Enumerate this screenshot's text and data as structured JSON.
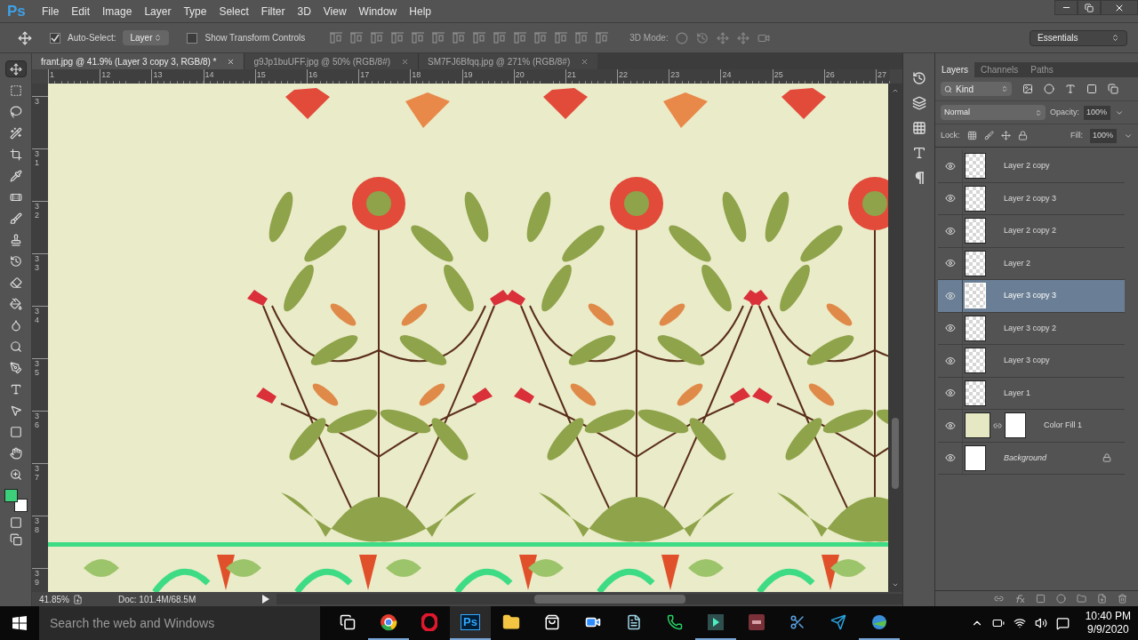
{
  "app": {
    "logo": "Ps",
    "menu": [
      "File",
      "Edit",
      "Image",
      "Layer",
      "Type",
      "Select",
      "Filter",
      "3D",
      "View",
      "Window",
      "Help"
    ]
  },
  "options_bar": {
    "auto_select": {
      "label": "Auto-Select:",
      "checked": true,
      "target": "Layer"
    },
    "transform_controls": {
      "label": "Show Transform Controls",
      "checked": false
    },
    "mode_label": "3D Mode:",
    "workspace": "Essentials"
  },
  "tools": [
    {
      "kind": "move",
      "selected": true
    },
    {
      "kind": "marquee",
      "selected": false
    },
    {
      "kind": "lasso",
      "selected": false
    },
    {
      "kind": "wand",
      "selected": false
    },
    {
      "kind": "crop",
      "selected": false
    },
    {
      "kind": "eyedropper",
      "selected": false
    },
    {
      "kind": "healing",
      "selected": false
    },
    {
      "kind": "brush",
      "selected": false
    },
    {
      "kind": "stamp",
      "selected": false
    },
    {
      "kind": "history",
      "selected": false
    },
    {
      "kind": "eraser",
      "selected": false
    },
    {
      "kind": "bucket",
      "selected": false
    },
    {
      "kind": "blur",
      "selected": false
    },
    {
      "kind": "dodge",
      "selected": false
    },
    {
      "kind": "pen",
      "selected": false
    },
    {
      "kind": "type",
      "selected": false
    },
    {
      "kind": "select",
      "selected": false
    },
    {
      "kind": "shape",
      "selected": false
    },
    {
      "kind": "hand",
      "selected": false
    },
    {
      "kind": "zoom",
      "selected": false
    }
  ],
  "document_tabs": [
    {
      "title": "frant.jpg @ 41.9% (Layer 3 copy 3, RGB/8) *",
      "selected": true
    },
    {
      "title": "g9Jp1buUFF.jpg @ 50% (RGB/8#)",
      "selected": false
    },
    {
      "title": "SM7FJ6Bfqq.jpg @ 271% (RGB/8#)",
      "selected": false
    }
  ],
  "rulers": {
    "horizontal": [
      "1",
      "12",
      "13",
      "14",
      "15",
      "16",
      "17",
      "18",
      "19",
      "20",
      "21",
      "22",
      "23",
      "24",
      "25",
      "26",
      "27"
    ],
    "vertical": [
      "3",
      "31",
      "32",
      "33",
      "34",
      "35",
      "36",
      "37",
      "38",
      "39"
    ]
  },
  "status_bar": {
    "zoom": "41.85%",
    "doc": "Doc: 101.4M/68.5M"
  },
  "layers_panel": {
    "tabs": [
      {
        "label": "Layers",
        "selected": true
      },
      {
        "label": "Channels",
        "selected": false
      },
      {
        "label": "Paths",
        "selected": false
      }
    ],
    "filter": "Kind",
    "blend_mode": "Normal",
    "opacity_label": "Opacity:",
    "opacity": "100%",
    "lock_label": "Lock:",
    "fill_label": "Fill:",
    "fill": "100%",
    "layers": [
      {
        "name": "Layer 2 copy",
        "kind": "pixel",
        "visible": true,
        "selected": false
      },
      {
        "name": "Layer 2 copy 3",
        "kind": "pixel",
        "visible": true,
        "selected": false
      },
      {
        "name": "Layer 2 copy 2",
        "kind": "pixel",
        "visible": true,
        "selected": false
      },
      {
        "name": "Layer 2",
        "kind": "pixel",
        "visible": true,
        "selected": false
      },
      {
        "name": "Layer 3 copy 3",
        "kind": "pixel",
        "visible": true,
        "selected": true
      },
      {
        "name": "Layer 3 copy 2",
        "kind": "pixel",
        "visible": true,
        "selected": false
      },
      {
        "name": "Layer 3 copy",
        "kind": "pixel",
        "visible": true,
        "selected": false
      },
      {
        "name": "Layer 1",
        "kind": "pixel",
        "visible": true,
        "selected": false
      },
      {
        "name": "Color Fill 1",
        "kind": "fill",
        "color": "#e6e8c4",
        "visible": true,
        "selected": false
      },
      {
        "name": "Background",
        "kind": "background",
        "visible": true,
        "selected": false,
        "locked": true
      }
    ]
  },
  "taskbar": {
    "search_placeholder": "Search the web and Windows",
    "apps": [
      {
        "kind": "task-view",
        "running": false,
        "selected": false
      },
      {
        "kind": "chrome",
        "running": true,
        "selected": false
      },
      {
        "kind": "opera",
        "running": false,
        "selected": false
      },
      {
        "kind": "photoshop",
        "label": "Ps",
        "running": true,
        "selected": true
      },
      {
        "kind": "explorer",
        "running": false,
        "selected": false
      },
      {
        "kind": "store",
        "running": false,
        "selected": false
      },
      {
        "kind": "zoom",
        "running": false,
        "selected": false
      },
      {
        "kind": "notepad",
        "running": false,
        "selected": false
      },
      {
        "kind": "whatsapp",
        "running": false,
        "selected": false
      },
      {
        "kind": "filmora",
        "running": true,
        "selected": false
      },
      {
        "kind": "recorder",
        "running": false,
        "selected": false
      },
      {
        "kind": "snip",
        "running": false,
        "selected": false
      },
      {
        "kind": "telegram",
        "running": false,
        "selected": false
      },
      {
        "kind": "idm",
        "running": true,
        "selected": false
      }
    ],
    "time": "10:40 PM",
    "date": "9/9/2020"
  }
}
